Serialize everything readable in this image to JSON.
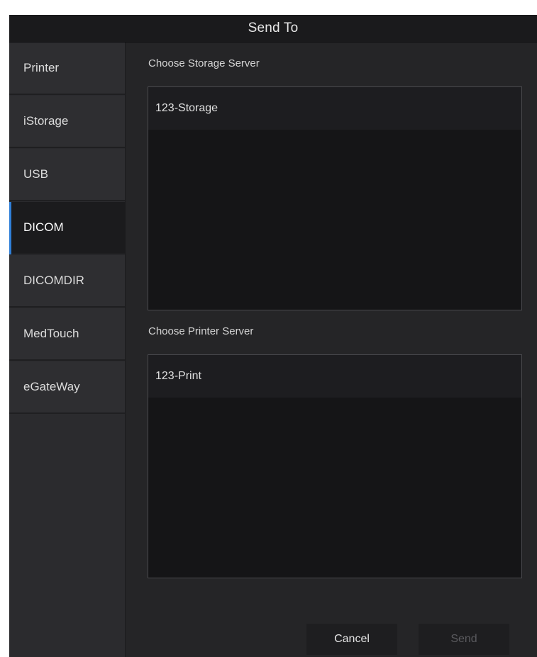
{
  "dialog": {
    "title": "Send To"
  },
  "sidebar": {
    "items": [
      {
        "label": "Printer",
        "active": false
      },
      {
        "label": "iStorage",
        "active": false
      },
      {
        "label": "USB",
        "active": false
      },
      {
        "label": "DICOM",
        "active": true
      },
      {
        "label": "DICOMDIR",
        "active": false
      },
      {
        "label": "MedTouch",
        "active": false
      },
      {
        "label": "eGateWay",
        "active": false
      }
    ]
  },
  "storage": {
    "label": "Choose Storage Server",
    "items": [
      "123-Storage"
    ]
  },
  "printer": {
    "label": "Choose Printer Server",
    "items": [
      "123-Print"
    ]
  },
  "buttons": {
    "cancel": "Cancel",
    "send": "Send",
    "send_enabled": false
  },
  "colors": {
    "accent": "#2f7fd8",
    "dialog_bg": "#232325",
    "list_bg": "#151517"
  }
}
